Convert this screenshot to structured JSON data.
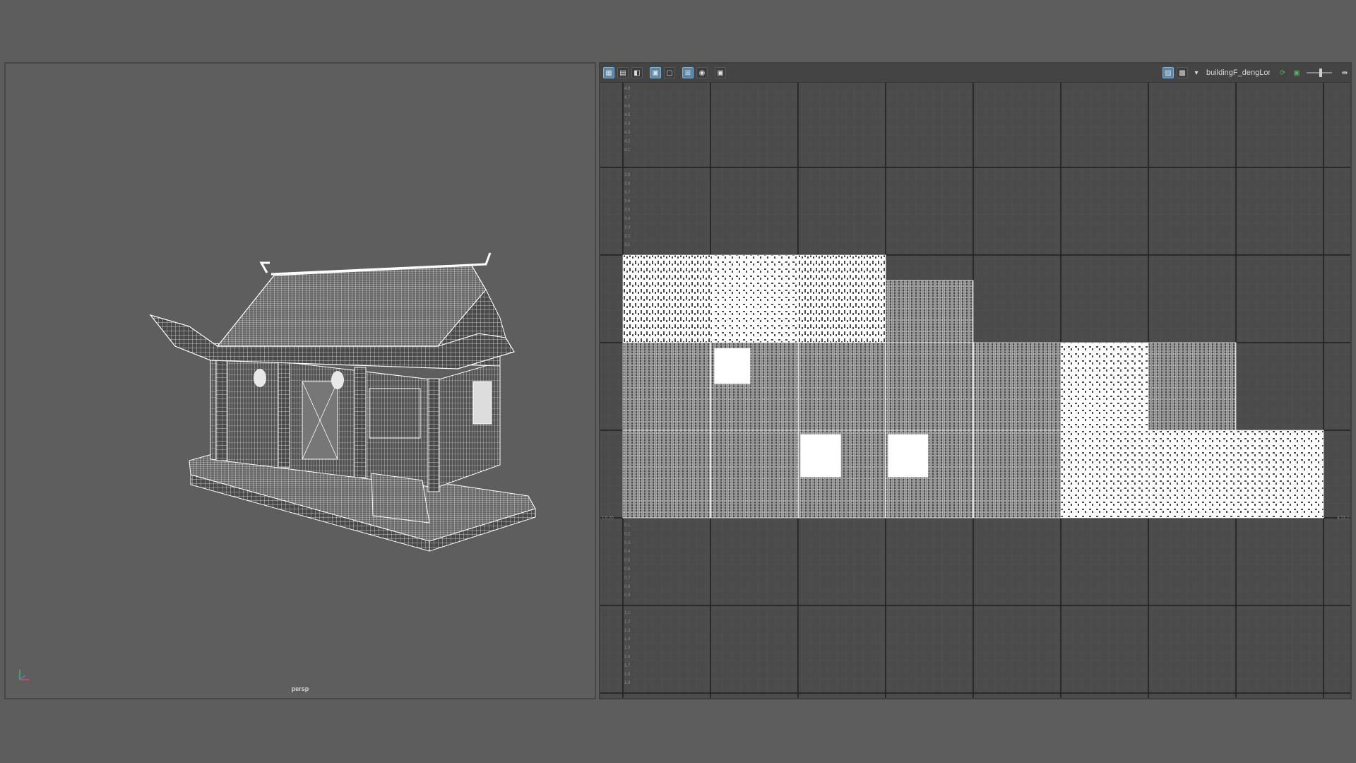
{
  "viewport": {
    "camera_label": "persp"
  },
  "uv_editor": {
    "toolbar_left_icons": [
      "uv-select-icon",
      "uv-transform-icon",
      "uv-shell-icon",
      "uv-grid-toggle-icon",
      "uv-edge-icon",
      "uv-checker-icon",
      "uv-display-icon",
      "uv-snapshot-icon"
    ],
    "toolbar_right_icons": [
      "texture-display-icon",
      "checker-pattern-icon",
      "dropdown-icon",
      "refresh-icon",
      "image-icon",
      "slider-icon",
      "split-icon"
    ],
    "texture_name": "buildingF_dengLong",
    "v_ticks_top": [
      "4.9",
      "4.7",
      "4.6",
      "4.5",
      "4.4",
      "4.3",
      "4.2",
      "4.1"
    ],
    "v_ticks_mid": [
      "3.9",
      "3.8",
      "3.7",
      "3.6",
      "3.5",
      "3.4",
      "3.3",
      "3.2",
      "3.1"
    ],
    "v_ticks_low": [
      "0.1",
      "0.2",
      "0.3",
      "0.4",
      "0.5",
      "0.6",
      "0.7",
      "0.8",
      "0.9"
    ],
    "v_ticks_bottom": [
      "1.1",
      "1.2",
      "1.3",
      "1.4",
      "1.5",
      "1.6",
      "1.7",
      "1.8",
      "1.9"
    ],
    "left_marker": "1.0.20",
    "right_marker": "8.13.2"
  },
  "colors": {
    "background": "#5d5d5d",
    "uv_background": "#4b4b4b",
    "wireframe": "#ffffff",
    "grid_major": "#1f1f1f",
    "active_icon": "#5a87a8"
  }
}
